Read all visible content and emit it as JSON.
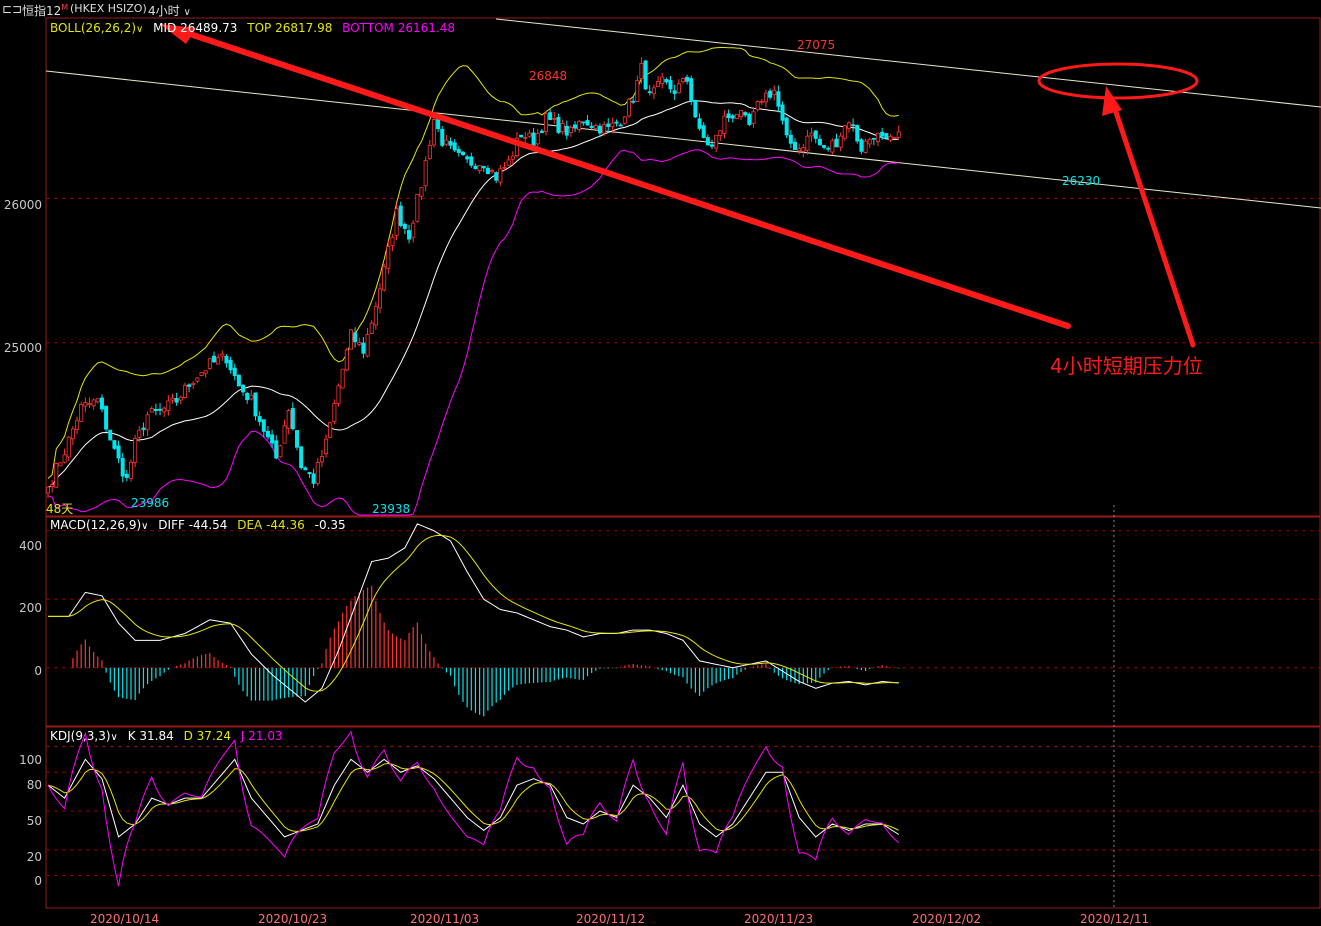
{
  "toolbar": {
    "menu_glyph": "⊏⊐",
    "symbol": "恒指12",
    "symbol_sup": "M",
    "exchange": "(HKEX HSIZO)",
    "period": "4小时",
    "dropdown_glyph": "∨"
  },
  "colors": {
    "up": "#ff3232",
    "down": "#00e5ee",
    "mid": "#ffffff",
    "upper": "#e6e600",
    "lower": "#ff00ff",
    "grid": "#8b0000",
    "frame": "#9a1a1a",
    "annotation": "#ff1a1a",
    "trend": "#e8e8c8",
    "text_yellow": "#e6e600",
    "text_magenta": "#ff00ff"
  },
  "boll_legend": {
    "name": "BOLL(26,26,2)",
    "mid_label": "MID",
    "mid_value": "26489.73",
    "top_label": "TOP",
    "top_value": "26817.98",
    "bottom_label": "BOTTOM",
    "bottom_value": "26161.48"
  },
  "macd_legend": {
    "name": "MACD(12,26,9)",
    "diff_label": "DIFF",
    "diff_value": "-44.54",
    "dea_label": "DEA",
    "dea_value": "-44.36",
    "macd_value": "-0.35"
  },
  "kdj_legend": {
    "name": "KDJ(9,3,3)",
    "k_label": "K",
    "k_value": "31.84",
    "d_label": "D",
    "d_value": "37.24",
    "j_label": "J",
    "j_value": "21.03"
  },
  "price_axis": [
    "26000",
    "25000"
  ],
  "macd_axis": [
    "400",
    "200",
    "0"
  ],
  "kdj_axis": [
    "100",
    "80",
    "50",
    "20",
    "0"
  ],
  "date_axis": [
    "2020/10/14",
    "2020/10/23",
    "2020/11/03",
    "2020/11/12",
    "2020/11/23",
    "2020/12/02",
    "2020/12/11"
  ],
  "corner_label": "48天",
  "price_labels": [
    "26848",
    "27075",
    "23986",
    "23938",
    "26230"
  ],
  "annotation_text": "4小时短期压力位",
  "chart_data": [
    {
      "type": "candlestick",
      "title": "恒指12 (HKEX HSIZO) 4小时",
      "indicator": "BOLL(26,26,2)",
      "ylim": [
        23800,
        27250
      ],
      "gridlines": [
        26000,
        25000
      ],
      "x_ticks": [
        "2020/10/14",
        "2020/10/23",
        "2020/11/03",
        "2020/11/12",
        "2020/11/23",
        "2020/12/02",
        "2020/12/11"
      ],
      "anchors": [
        {
          "i": 0,
          "v": 24000
        },
        {
          "i": 4,
          "v": 24250
        },
        {
          "i": 8,
          "v": 24550
        },
        {
          "i": 12,
          "v": 24600
        },
        {
          "i": 16,
          "v": 24250
        },
        {
          "i": 19,
          "v": 24050
        },
        {
          "i": 21,
          "v": 24300
        },
        {
          "i": 24,
          "v": 24500
        },
        {
          "i": 27,
          "v": 24520
        },
        {
          "i": 31,
          "v": 24600
        },
        {
          "i": 35,
          "v": 24750
        },
        {
          "i": 39,
          "v": 24850
        },
        {
          "i": 43,
          "v": 24900
        },
        {
          "i": 46,
          "v": 24700
        },
        {
          "i": 49,
          "v": 24600
        },
        {
          "i": 52,
          "v": 24400
        },
        {
          "i": 55,
          "v": 24200
        },
        {
          "i": 58,
          "v": 24550
        },
        {
          "i": 61,
          "v": 24150
        },
        {
          "i": 64,
          "v": 24050
        },
        {
          "i": 67,
          "v": 24300
        },
        {
          "i": 70,
          "v": 24700
        },
        {
          "i": 73,
          "v": 25050
        },
        {
          "i": 76,
          "v": 24950
        },
        {
          "i": 78,
          "v": 25150
        },
        {
          "i": 81,
          "v": 25500
        },
        {
          "i": 84,
          "v": 25900
        },
        {
          "i": 87,
          "v": 25750
        },
        {
          "i": 90,
          "v": 26100
        },
        {
          "i": 93,
          "v": 26550
        },
        {
          "i": 95,
          "v": 26400
        },
        {
          "i": 98,
          "v": 26300
        },
        {
          "i": 101,
          "v": 26250
        },
        {
          "i": 105,
          "v": 26250
        },
        {
          "i": 108,
          "v": 26150
        },
        {
          "i": 111,
          "v": 26250
        },
        {
          "i": 114,
          "v": 26450
        },
        {
          "i": 117,
          "v": 26400
        },
        {
          "i": 120,
          "v": 26550
        },
        {
          "i": 123,
          "v": 26500
        },
        {
          "i": 126,
          "v": 26450
        },
        {
          "i": 129,
          "v": 26550
        },
        {
          "i": 132,
          "v": 26500
        },
        {
          "i": 135,
          "v": 26480
        },
        {
          "i": 138,
          "v": 26550
        },
        {
          "i": 141,
          "v": 26700
        },
        {
          "i": 143,
          "v": 26900
        },
        {
          "i": 145,
          "v": 26700
        },
        {
          "i": 148,
          "v": 26800
        },
        {
          "i": 151,
          "v": 26750
        },
        {
          "i": 154,
          "v": 26820
        },
        {
          "i": 157,
          "v": 26450
        },
        {
          "i": 160,
          "v": 26350
        },
        {
          "i": 163,
          "v": 26550
        },
        {
          "i": 166,
          "v": 26600
        },
        {
          "i": 169,
          "v": 26500
        },
        {
          "i": 172,
          "v": 26700
        },
        {
          "i": 175,
          "v": 26750
        },
        {
          "i": 178,
          "v": 26400
        },
        {
          "i": 181,
          "v": 26350
        },
        {
          "i": 184,
          "v": 26450
        },
        {
          "i": 187,
          "v": 26330
        },
        {
          "i": 190,
          "v": 26400
        },
        {
          "i": 193,
          "v": 26550
        },
        {
          "i": 196,
          "v": 26350
        },
        {
          "i": 199,
          "v": 26450
        },
        {
          "i": 202,
          "v": 26380
        },
        {
          "i": 205,
          "v": 26420
        }
      ],
      "extremes": [
        {
          "label": "23986",
          "value": 23986
        },
        {
          "label": "23938",
          "value": 23938
        },
        {
          "label": "26848",
          "value": 26848
        },
        {
          "label": "27075",
          "value": 27075
        },
        {
          "label": "26230",
          "value": 26230
        }
      ],
      "boll_last": {
        "mid": 26489.73,
        "top": 26817.98,
        "bottom": 26161.48
      },
      "annotation": "4小时短期压力位"
    },
    {
      "type": "macd",
      "indicator": "MACD(12,26,9)",
      "ylim": [
        -170,
        440
      ],
      "gridlines": [
        400,
        200,
        0
      ],
      "diff_anchors": [
        {
          "i": 0,
          "v": 150
        },
        {
          "i": 5,
          "v": 150
        },
        {
          "i": 9,
          "v": 220
        },
        {
          "i": 13,
          "v": 210
        },
        {
          "i": 17,
          "v": 130
        },
        {
          "i": 21,
          "v": 80
        },
        {
          "i": 27,
          "v": 80
        },
        {
          "i": 33,
          "v": 100
        },
        {
          "i": 39,
          "v": 140
        },
        {
          "i": 44,
          "v": 130
        },
        {
          "i": 49,
          "v": 40
        },
        {
          "i": 54,
          "v": -20
        },
        {
          "i": 58,
          "v": -60
        },
        {
          "i": 62,
          "v": -100
        },
        {
          "i": 66,
          "v": -60
        },
        {
          "i": 70,
          "v": 50
        },
        {
          "i": 74,
          "v": 180
        },
        {
          "i": 78,
          "v": 310
        },
        {
          "i": 82,
          "v": 320
        },
        {
          "i": 86,
          "v": 350
        },
        {
          "i": 89,
          "v": 420
        },
        {
          "i": 93,
          "v": 400
        },
        {
          "i": 97,
          "v": 370
        },
        {
          "i": 101,
          "v": 280
        },
        {
          "i": 105,
          "v": 200
        },
        {
          "i": 109,
          "v": 170
        },
        {
          "i": 113,
          "v": 160
        },
        {
          "i": 117,
          "v": 140
        },
        {
          "i": 121,
          "v": 120
        },
        {
          "i": 125,
          "v": 110
        },
        {
          "i": 129,
          "v": 90
        },
        {
          "i": 133,
          "v": 100
        },
        {
          "i": 137,
          "v": 100
        },
        {
          "i": 141,
          "v": 110
        },
        {
          "i": 145,
          "v": 110
        },
        {
          "i": 149,
          "v": 100
        },
        {
          "i": 153,
          "v": 80
        },
        {
          "i": 157,
          "v": 20
        },
        {
          "i": 161,
          "v": 10
        },
        {
          "i": 165,
          "v": 0
        },
        {
          "i": 169,
          "v": 10
        },
        {
          "i": 173,
          "v": 20
        },
        {
          "i": 177,
          "v": -10
        },
        {
          "i": 181,
          "v": -40
        },
        {
          "i": 185,
          "v": -60
        },
        {
          "i": 189,
          "v": -45
        },
        {
          "i": 193,
          "v": -40
        },
        {
          "i": 197,
          "v": -50
        },
        {
          "i": 201,
          "v": -40
        },
        {
          "i": 205,
          "v": -44.54
        }
      ],
      "dea_last": -44.36,
      "macd_last": -0.35
    },
    {
      "type": "kdj",
      "indicator": "KDJ(9,3,3)",
      "ylim": [
        -25,
        115
      ],
      "gridlines": [
        100,
        80,
        50,
        20,
        0
      ],
      "k_anchors": [
        {
          "i": 0,
          "v": 70
        },
        {
          "i": 4,
          "v": 60
        },
        {
          "i": 9,
          "v": 90
        },
        {
          "i": 13,
          "v": 75
        },
        {
          "i": 17,
          "v": 30
        },
        {
          "i": 21,
          "v": 40
        },
        {
          "i": 25,
          "v": 60
        },
        {
          "i": 29,
          "v": 55
        },
        {
          "i": 33,
          "v": 60
        },
        {
          "i": 37,
          "v": 60
        },
        {
          "i": 41,
          "v": 75
        },
        {
          "i": 45,
          "v": 90
        },
        {
          "i": 49,
          "v": 60
        },
        {
          "i": 53,
          "v": 45
        },
        {
          "i": 57,
          "v": 30
        },
        {
          "i": 61,
          "v": 35
        },
        {
          "i": 65,
          "v": 40
        },
        {
          "i": 69,
          "v": 70
        },
        {
          "i": 73,
          "v": 90
        },
        {
          "i": 77,
          "v": 80
        },
        {
          "i": 81,
          "v": 90
        },
        {
          "i": 85,
          "v": 80
        },
        {
          "i": 89,
          "v": 85
        },
        {
          "i": 93,
          "v": 75
        },
        {
          "i": 97,
          "v": 60
        },
        {
          "i": 101,
          "v": 45
        },
        {
          "i": 105,
          "v": 35
        },
        {
          "i": 109,
          "v": 45
        },
        {
          "i": 113,
          "v": 70
        },
        {
          "i": 117,
          "v": 75
        },
        {
          "i": 121,
          "v": 70
        },
        {
          "i": 125,
          "v": 45
        },
        {
          "i": 129,
          "v": 40
        },
        {
          "i": 133,
          "v": 50
        },
        {
          "i": 137,
          "v": 45
        },
        {
          "i": 141,
          "v": 70
        },
        {
          "i": 145,
          "v": 60
        },
        {
          "i": 149,
          "v": 45
        },
        {
          "i": 153,
          "v": 70
        },
        {
          "i": 157,
          "v": 40
        },
        {
          "i": 161,
          "v": 30
        },
        {
          "i": 165,
          "v": 40
        },
        {
          "i": 169,
          "v": 60
        },
        {
          "i": 173,
          "v": 80
        },
        {
          "i": 177,
          "v": 80
        },
        {
          "i": 181,
          "v": 45
        },
        {
          "i": 185,
          "v": 30
        },
        {
          "i": 189,
          "v": 40
        },
        {
          "i": 193,
          "v": 35
        },
        {
          "i": 197,
          "v": 40
        },
        {
          "i": 201,
          "v": 40
        },
        {
          "i": 205,
          "v": 31.84
        }
      ],
      "d_last": 37.24,
      "j_last": 21.03
    }
  ]
}
